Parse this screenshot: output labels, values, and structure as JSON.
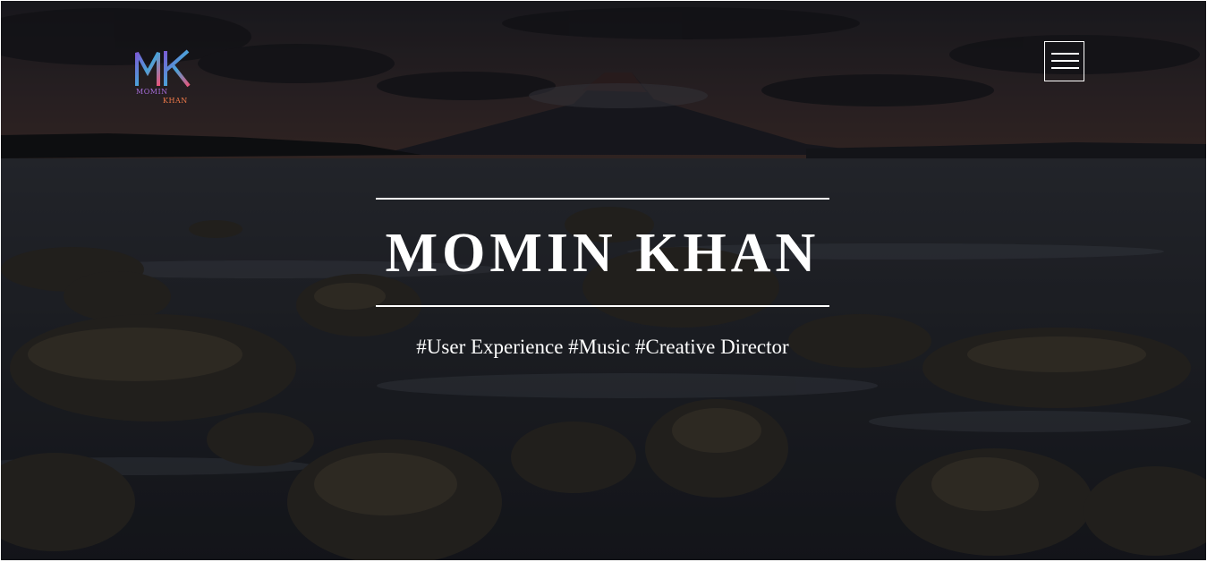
{
  "hero": {
    "background_image": "volcano-lake-rocks-dusk",
    "logo": {
      "monogram": "MK",
      "line1": "MOMIN",
      "line2": "KHAN"
    },
    "menu_icon": "hamburger-icon",
    "title": "MOMIN KHAN",
    "tagline": "#User Experience #Music #Creative Director"
  },
  "colors": {
    "text": "#ffffff",
    "overlay": "#1a1b22",
    "logo_purple": "#a46cd8",
    "logo_orange": "#f07a4a"
  }
}
